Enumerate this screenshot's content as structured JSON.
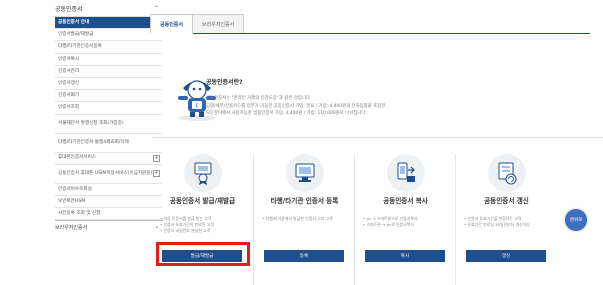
{
  "sidebar": {
    "header": "공동인증서",
    "items": [
      {
        "label": "공동인증서 안내",
        "active": true
      },
      {
        "label": "인증서발급/재발급"
      },
      {
        "label": "타행/타기관인증서등록"
      },
      {
        "label": "인증서복사"
      },
      {
        "label": "인증서관리"
      },
      {
        "label": "인증서갱신"
      },
      {
        "label": "인증서폐기"
      },
      {
        "label": "인증서조회"
      },
      {
        "label": "서울재단서 발행신청 조회(가입중)",
        "tall": true
      },
      {
        "label": "타행/타기관인증서 통행4제효회/삭제",
        "tall": true
      },
      {
        "label": "휴대폰인증서서비스",
        "plus": true
      },
      {
        "label": "공동인증서 휴대폰 USIM저장서비스(유심지원용)",
        "plus": true,
        "tall": true
      },
      {
        "label": "인증서비수조회설"
      },
      {
        "label": "보안토큰HSM"
      },
      {
        "label": "사전등록 조회 및 신청"
      }
    ],
    "footer": "브라우저인증서"
  },
  "tabs": [
    "공동인증서",
    "브라우저인증서"
  ],
  "intro": {
    "title": "공동인증서란?",
    "lines": [
      "공동인증서는 \"온라인 거래의 인감도장\"과 같은 것입니다.",
      "공항/세무/신용카드를 업무가 가능한 공동인증서 가입. 유료 / 가입: 4,400원과 전자입찰을 포함한",
      "모든분야에서 사용가능한 범용인증서 가입. 4,400원 / 가입: 110,000원로 나뉘집니다."
    ]
  },
  "cards": [
    {
      "title": "공동인증서 발급/재발급",
      "desc": [
        "• 처음 인증서를 발급 받는 고객",
        "• 인증서 유효기간이 만료된 고객",
        "• 인증서 비밀번호 분실한 고객"
      ],
      "button": "발급/재발급",
      "icon": "certificate-issue-icon"
    },
    {
      "title": "타행/타기관 인증서 등록",
      "desc": [
        "• 타행/타기관에서 발급한 인증서 소지 고객"
      ],
      "button": "등록",
      "icon": "certificate-register-icon"
    },
    {
      "title": "공동인증서 복사",
      "desc": [
        "• pc → 스마트폰으로 인증서복사",
        "• 스마트폰 → pc로 인증서복사"
      ],
      "button": "복사",
      "icon": "certificate-copy-icon"
    },
    {
      "title": "공동인증서 갱신",
      "desc": [
        "• 인증서 유효기간을 연장하는 고객",
        "• 유효기간 만료일 30일전부터 갱신가능"
      ],
      "button": "갱신",
      "icon": "certificate-renew-icon"
    }
  ],
  "float_button": "맨위로",
  "colors": {
    "accent": "#1e4e8c",
    "highlight": "#e21b1b"
  }
}
